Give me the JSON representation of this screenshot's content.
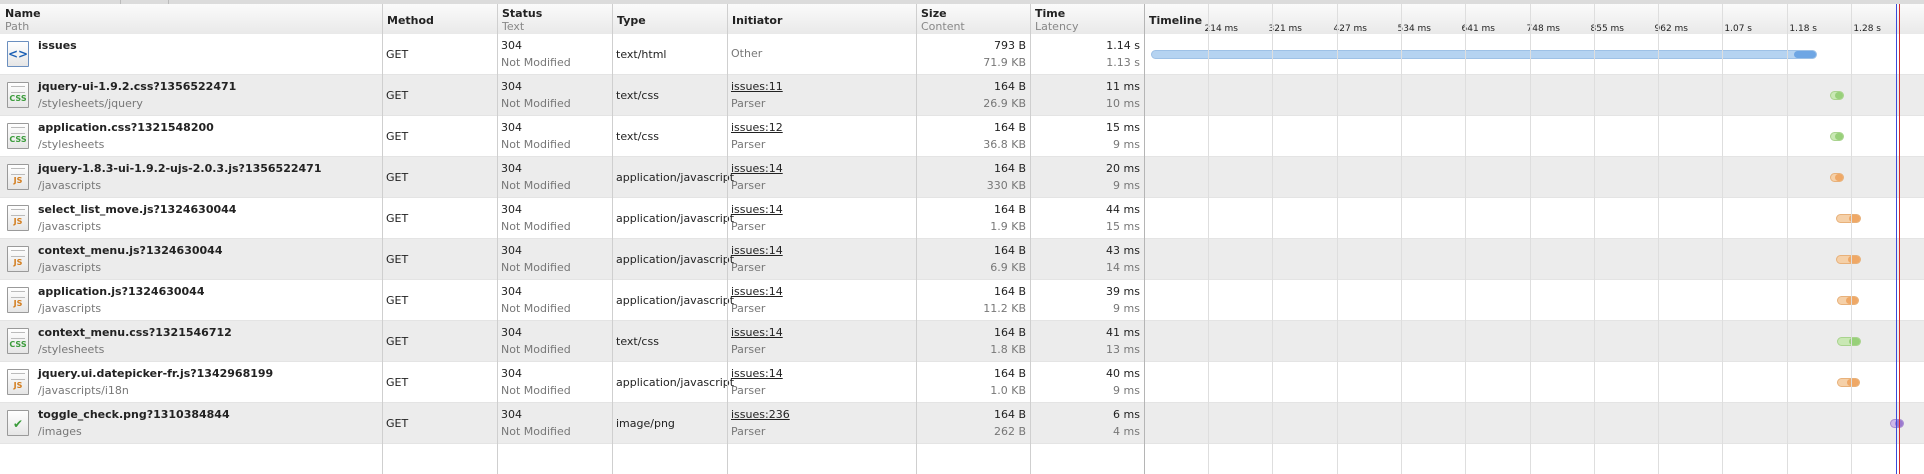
{
  "columns": {
    "name": {
      "title": "Name",
      "sub": "Path"
    },
    "method": {
      "title": "Method"
    },
    "status": {
      "title": "Status",
      "sub": "Text"
    },
    "type": {
      "title": "Type"
    },
    "initiator": {
      "title": "Initiator"
    },
    "size": {
      "title": "Size",
      "sub": "Content"
    },
    "time": {
      "title": "Time",
      "sub": "Latency"
    },
    "timeline": {
      "title": "Timeline"
    }
  },
  "timeline_ticks": [
    "214 ms",
    "321 ms",
    "427 ms",
    "534 ms",
    "641 ms",
    "748 ms",
    "855 ms",
    "962 ms",
    "1.07 s",
    "1.18 s",
    "1.28 s"
  ],
  "timeline_scale_seconds": 1.34,
  "requests": [
    {
      "name": "issues",
      "path": "",
      "icon": "html-file-icon",
      "kind": "html",
      "method": "GET",
      "status": "304",
      "status_text": "Not Modified",
      "type": "text/html",
      "initiator": "Other",
      "initiator_sub": "",
      "initiator_link": false,
      "size": "793 B",
      "content": "71.9 KB",
      "time": "1.14 s",
      "latency": "1.13 s",
      "start_s": 0.0,
      "latency_s": 1.13,
      "end_s": 1.175
    },
    {
      "name": "jquery-ui-1.9.2.css?1356522471",
      "path": "/stylesheets/jquery",
      "icon": "css-file-icon",
      "kind": "css",
      "method": "GET",
      "status": "304",
      "status_text": "Not Modified",
      "type": "text/css",
      "initiator": "issues:11",
      "initiator_sub": "Parser",
      "initiator_link": true,
      "size": "164 B",
      "content": "26.9 KB",
      "time": "11 ms",
      "latency": "10 ms",
      "start_s": 1.198,
      "latency_s": 0.01,
      "end_s": 1.211
    },
    {
      "name": "application.css?1321548200",
      "path": "/stylesheets",
      "icon": "css-file-icon",
      "kind": "css",
      "method": "GET",
      "status": "304",
      "status_text": "Not Modified",
      "type": "text/css",
      "initiator": "issues:12",
      "initiator_sub": "Parser",
      "initiator_link": true,
      "size": "164 B",
      "content": "36.8 KB",
      "time": "15 ms",
      "latency": "9 ms",
      "start_s": 1.198,
      "latency_s": 0.009,
      "end_s": 1.213
    },
    {
      "name": "jquery-1.8.3-ui-1.9.2-ujs-2.0.3.js?1356522471",
      "path": "/javascripts",
      "icon": "js-file-icon",
      "kind": "js",
      "method": "GET",
      "status": "304",
      "status_text": "Not Modified",
      "type": "application/javascript",
      "initiator": "issues:14",
      "initiator_sub": "Parser",
      "initiator_link": true,
      "size": "164 B",
      "content": "330 KB",
      "time": "20 ms",
      "latency": "9 ms",
      "start_s": 1.199,
      "latency_s": 0.009,
      "end_s": 1.219
    },
    {
      "name": "select_list_move.js?1324630044",
      "path": "/javascripts",
      "icon": "js-file-icon",
      "kind": "js",
      "method": "GET",
      "status": "304",
      "status_text": "Not Modified",
      "type": "application/javascript",
      "initiator": "issues:14",
      "initiator_sub": "Parser",
      "initiator_link": true,
      "size": "164 B",
      "content": "1.9 KB",
      "time": "44 ms",
      "latency": "15 ms",
      "start_s": 1.21,
      "latency_s": 0.015,
      "end_s": 1.254
    },
    {
      "name": "context_menu.js?1324630044",
      "path": "/javascripts",
      "icon": "js-file-icon",
      "kind": "js",
      "method": "GET",
      "status": "304",
      "status_text": "Not Modified",
      "type": "application/javascript",
      "initiator": "issues:14",
      "initiator_sub": "Parser",
      "initiator_link": true,
      "size": "164 B",
      "content": "6.9 KB",
      "time": "43 ms",
      "latency": "14 ms",
      "start_s": 1.21,
      "latency_s": 0.014,
      "end_s": 1.253
    },
    {
      "name": "application.js?1324630044",
      "path": "/javascripts",
      "icon": "js-file-icon",
      "kind": "js",
      "method": "GET",
      "status": "304",
      "status_text": "Not Modified",
      "type": "application/javascript",
      "initiator": "issues:14",
      "initiator_sub": "Parser",
      "initiator_link": true,
      "size": "164 B",
      "content": "11.2 KB",
      "time": "39 ms",
      "latency": "9 ms",
      "start_s": 1.211,
      "latency_s": 0.009,
      "end_s": 1.25
    },
    {
      "name": "context_menu.css?1321546712",
      "path": "/stylesheets",
      "icon": "css-file-icon",
      "kind": "css",
      "method": "GET",
      "status": "304",
      "status_text": "Not Modified",
      "type": "text/css",
      "initiator": "issues:14",
      "initiator_sub": "Parser",
      "initiator_link": true,
      "size": "164 B",
      "content": "1.8 KB",
      "time": "41 ms",
      "latency": "13 ms",
      "start_s": 1.212,
      "latency_s": 0.013,
      "end_s": 1.253
    },
    {
      "name": "jquery.ui.datepicker-fr.js?1342968199",
      "path": "/javascripts/i18n",
      "icon": "js-file-icon",
      "kind": "js",
      "method": "GET",
      "status": "304",
      "status_text": "Not Modified",
      "type": "application/javascript",
      "initiator": "issues:14",
      "initiator_sub": "Parser",
      "initiator_link": true,
      "size": "164 B",
      "content": "1.0 KB",
      "time": "40 ms",
      "latency": "9 ms",
      "start_s": 1.212,
      "latency_s": 0.009,
      "end_s": 1.252
    },
    {
      "name": "toggle_check.png?1310384844",
      "path": "/images",
      "icon": "image-file-icon",
      "kind": "img",
      "method": "GET",
      "status": "304",
      "status_text": "Not Modified",
      "type": "image/png",
      "initiator": "issues:236",
      "initiator_sub": "Parser",
      "initiator_link": true,
      "size": "164 B",
      "content": "262 B",
      "time": "6 ms",
      "latency": "4 ms",
      "start_s": 1.305,
      "latency_s": 0.004,
      "end_s": 1.311
    }
  ],
  "events": {
    "blue_s": 1.315,
    "red_s": 1.32
  }
}
